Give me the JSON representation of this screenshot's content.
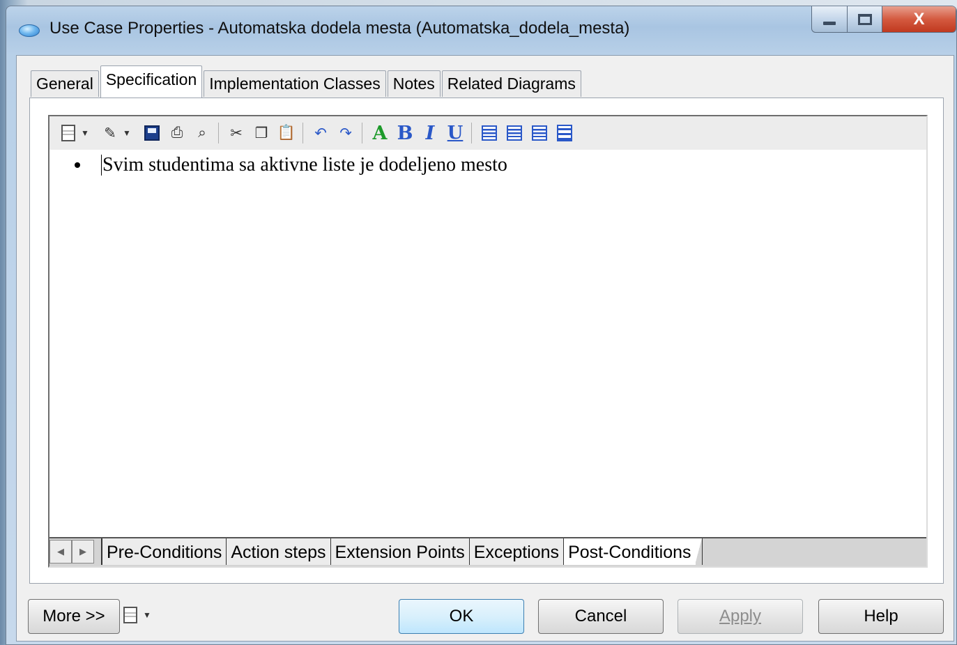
{
  "window": {
    "title": "Use Case Properties - Automatska dodela mesta (Automatska_dodela_mesta)",
    "controls": {
      "close_glyph": "X"
    }
  },
  "tabs": [
    {
      "label": "General",
      "active": false
    },
    {
      "label": "Specification",
      "active": true
    },
    {
      "label": "Implementation Classes",
      "active": false
    },
    {
      "label": "Notes",
      "active": false
    },
    {
      "label": "Related Diagrams",
      "active": false
    }
  ],
  "editor": {
    "toolbar_icons": [
      "document-menu-icon",
      "edit-menu-icon",
      "save-icon",
      "print-icon",
      "find-icon",
      "cut-icon",
      "copy-icon",
      "paste-icon",
      "undo-icon",
      "redo-icon",
      "font-color-icon",
      "bold-icon",
      "italic-icon",
      "underline-icon",
      "align-left-icon",
      "align-center-icon",
      "align-right-icon",
      "bullet-list-icon"
    ],
    "toolbar_letters": {
      "font": "A",
      "bold": "B",
      "italic": "I",
      "underline": "U"
    },
    "content_lines": [
      "Svim studentima sa aktivne liste je dodeljeno mesto"
    ]
  },
  "sheet_tabs": [
    {
      "label": "Pre-Conditions",
      "active": false
    },
    {
      "label": "Action steps",
      "active": false
    },
    {
      "label": "Extension Points",
      "active": false
    },
    {
      "label": "Exceptions",
      "active": false
    },
    {
      "label": "Post-Conditions",
      "active": true
    }
  ],
  "buttons": {
    "more": "More >>",
    "ok": "OK",
    "cancel": "Cancel",
    "apply": "Apply",
    "help": "Help"
  },
  "colors": {
    "accent_blue": "#2a58c8",
    "font_green": "#1d9a2a",
    "close_red": "#c0391f",
    "default_button": "#bee6fd"
  }
}
